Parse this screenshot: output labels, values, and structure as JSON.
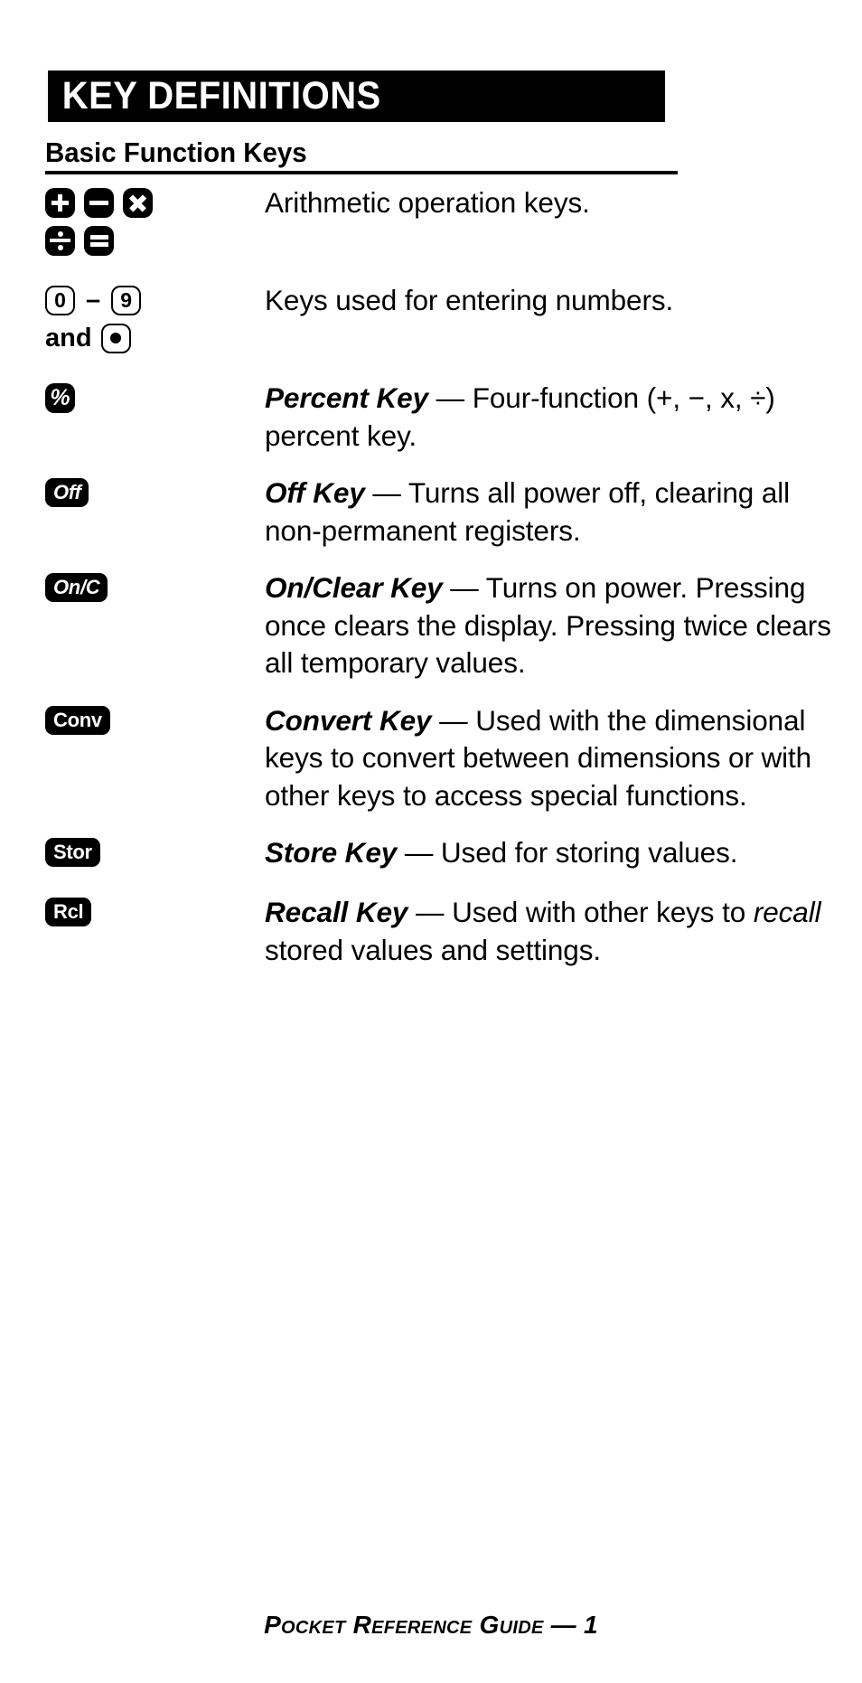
{
  "header": {
    "title": "KEY DEFINITIONS"
  },
  "section": {
    "heading": "Basic Function Keys"
  },
  "rows": [
    {
      "id": "arithmetic",
      "keys": [
        [
          {
            "type": "glyph",
            "glyph": "plus",
            "label": "+"
          },
          {
            "type": "glyph",
            "glyph": "minus",
            "label": "−"
          },
          {
            "type": "glyph",
            "glyph": "times",
            "label": "x"
          }
        ],
        [
          {
            "type": "glyph",
            "glyph": "divide",
            "label": "÷"
          },
          {
            "type": "glyph",
            "glyph": "equals",
            "label": "="
          }
        ]
      ],
      "definition": "Arithmetic operation keys."
    },
    {
      "id": "digits",
      "keys": [
        [
          {
            "type": "outline",
            "label": "0"
          },
          {
            "type": "sep",
            "label": "–"
          },
          {
            "type": "outline",
            "label": "9"
          }
        ],
        [
          {
            "type": "word",
            "label": "and"
          },
          {
            "type": "outline-dot",
            "label": "·"
          }
        ]
      ],
      "definition": "Keys used for entering numbers."
    },
    {
      "id": "percent",
      "keys": [
        [
          {
            "type": "glyph",
            "glyph": "percent",
            "label": "%"
          }
        ]
      ],
      "term": "Percent Key",
      "dash": " — ",
      "definition": "Four-function (+, −, x, ÷) percent key."
    },
    {
      "id": "off",
      "keys": [
        [
          {
            "type": "wide-italic",
            "label": "Off"
          }
        ]
      ],
      "term": "Off Key",
      "dash": " — ",
      "definition": "Turns all power off, clearing all non-permanent registers."
    },
    {
      "id": "on-clear",
      "keys": [
        [
          {
            "type": "wide-italic",
            "label": "On/C"
          }
        ]
      ],
      "term": "On/Clear Key",
      "dash": " — ",
      "definition": "Turns on power. Pressing once clears the display. Pressing twice clears all temporary values."
    },
    {
      "id": "convert",
      "keys": [
        [
          {
            "type": "wide-upright",
            "label": "Conv"
          }
        ]
      ],
      "term": "Convert Key",
      "dash": " — ",
      "definition": "Used with the dimensional keys to convert between dimensions or with other keys to access special functions."
    },
    {
      "id": "store",
      "keys": [
        [
          {
            "type": "wide-upright",
            "label": "Stor"
          }
        ]
      ],
      "term": "Store Key",
      "dash": " — ",
      "definition": "Used for storing values."
    },
    {
      "id": "recall",
      "keys": [
        [
          {
            "type": "wide-upright",
            "label": "Rcl"
          }
        ]
      ],
      "term": "Recall Key",
      "dash": " — ",
      "definition_pre": "Used with other keys to ",
      "definition_em": "recall",
      "definition_post": " stored values and settings."
    }
  ],
  "footer": {
    "text": "Pocket Reference Guide — 1"
  }
}
